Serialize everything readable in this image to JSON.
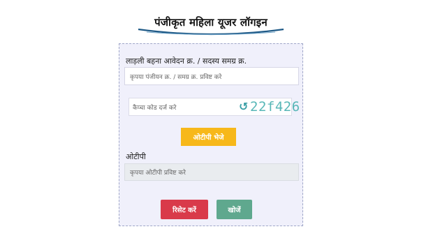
{
  "page": {
    "title": "पंजीकृत महिला यूजर लॉगइन"
  },
  "form": {
    "id_label": "लाड़ली बहना आवेदन क्र. / सदस्य समग्र क्र.",
    "id_placeholder": "कृपया पंजीयन क्र. / समग्र क्र. प्रविष्ट करे",
    "captcha_placeholder": "कैप्चा कोड दर्ज करे",
    "captcha_refresh_icon": "refresh-icon",
    "captcha_code": "22f426",
    "send_otp_label": "ओटीपी भेजे",
    "otp_label": "ओटीपी",
    "otp_placeholder": "कृपया ओटीपी प्रविष्ट करे",
    "reset_label": "रिसेट करें",
    "search_label": "खोजें"
  },
  "colors": {
    "card_bg": "#f0f0fb",
    "otp_button": "#f7b81a",
    "reset_button": "#d93a4a",
    "search_button": "#5fa88e",
    "captcha_text": "#58b7b7",
    "underline": "#1f5a87"
  }
}
